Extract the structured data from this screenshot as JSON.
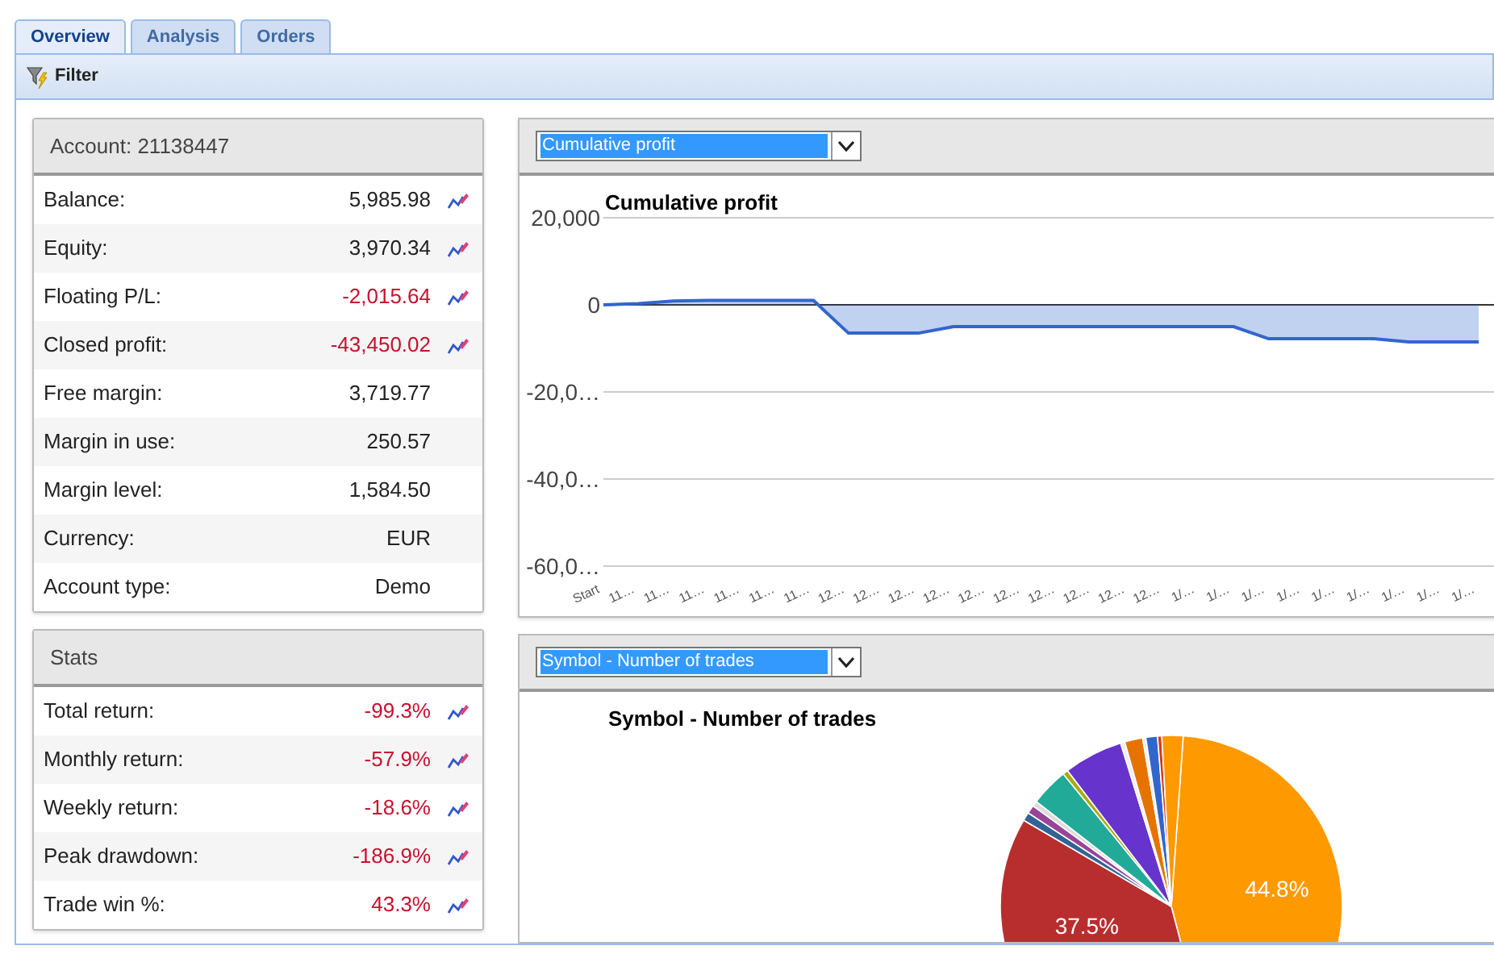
{
  "tabs": [
    {
      "label": "Overview",
      "selected": true
    },
    {
      "label": "Analysis",
      "selected": false
    },
    {
      "label": "Orders",
      "selected": false
    }
  ],
  "toolbar": {
    "filter_button": "Filter"
  },
  "account": {
    "title": "Account: 21138447",
    "rows": [
      {
        "label": "Balance:",
        "value": "5,985.98",
        "color": "#222222",
        "chart_link": true
      },
      {
        "label": "Equity:",
        "value": "3,970.34",
        "color": "#222222",
        "chart_link": true
      },
      {
        "label": "Floating P/L:",
        "value": "-2,015.64",
        "color": "#c8102e",
        "chart_link": true
      },
      {
        "label": "Closed profit:",
        "value": "-43,450.02",
        "color": "#c8102e",
        "chart_link": true
      },
      {
        "label": "Free margin:",
        "value": "3,719.77",
        "color": "#222222",
        "chart_link": false
      },
      {
        "label": "Margin in use:",
        "value": "250.57",
        "color": "#222222",
        "chart_link": false
      },
      {
        "label": "Margin level:",
        "value": "1,584.50",
        "color": "#222222",
        "chart_link": false
      },
      {
        "label": "Currency:",
        "value": "EUR",
        "color": "#222222",
        "chart_link": false
      },
      {
        "label": "Account type:",
        "value": "Demo",
        "color": "#222222",
        "chart_link": false
      }
    ]
  },
  "stats": {
    "title": "Stats",
    "rows": [
      {
        "label": "Total return:",
        "value": "-99.3%",
        "color": "#c8102e",
        "chart_link": true
      },
      {
        "label": "Monthly return:",
        "value": "-57.9%",
        "color": "#c8102e",
        "chart_link": true
      },
      {
        "label": "Weekly return:",
        "value": "-18.6%",
        "color": "#c8102e",
        "chart_link": true
      },
      {
        "label": "Peak drawdown:",
        "value": "-186.9%",
        "color": "#c8102e",
        "chart_link": true
      },
      {
        "label": "Trade win %:",
        "value": "43.3%",
        "color": "#c8102e",
        "chart_link": true
      }
    ]
  },
  "profit_panel": {
    "dropdown": "Cumulative profit",
    "chart_data": {
      "type": "area",
      "title": "Cumulative profit",
      "categories": [
        "Start",
        "11…",
        "11…",
        "11…",
        "11…",
        "11…",
        "11…",
        "12…",
        "12…",
        "12…",
        "12…",
        "12…",
        "12…",
        "12…",
        "12…",
        "12…",
        "12…",
        "1/…",
        "1/…",
        "1/…",
        "1/…",
        "1/…",
        "1/…",
        "1/…",
        "1/…",
        "1/…"
      ],
      "series": [
        {
          "color": "#3366cc",
          "values": [
            0,
            300,
            900,
            1000,
            1000,
            1000,
            1000,
            -6500,
            -6500,
            -6500,
            -5000,
            -5000,
            -5000,
            -5000,
            -5000,
            -5000,
            -5000,
            -5000,
            -5000,
            -7800,
            -7800,
            -7800,
            -7800,
            -8500,
            -8500,
            -8500
          ]
        }
      ],
      "ylim": [
        -60000,
        20000
      ],
      "yticks": [
        {
          "value": 20000,
          "label": "20,000"
        },
        {
          "value": 0,
          "label": "0"
        },
        {
          "value": -20000,
          "label": "-20,0…"
        },
        {
          "value": -40000,
          "label": "-40,0…"
        },
        {
          "value": -60000,
          "label": "-60,0…"
        }
      ]
    }
  },
  "symbol_panel": {
    "dropdown": "Symbol - Number of trades",
    "chart_data": {
      "type": "pie",
      "title": "Symbol - Number of trades",
      "values": [
        44.8,
        37.5,
        0.8,
        0.8,
        0.5,
        3.6,
        0.5,
        5.6,
        0.4,
        1.7,
        0.3,
        1.1,
        0.4,
        2.0
      ],
      "value_labels": [
        "44.8%",
        "37.5%",
        null,
        null,
        null,
        null,
        null,
        null,
        null,
        null,
        null,
        null,
        null,
        null
      ]
    }
  }
}
